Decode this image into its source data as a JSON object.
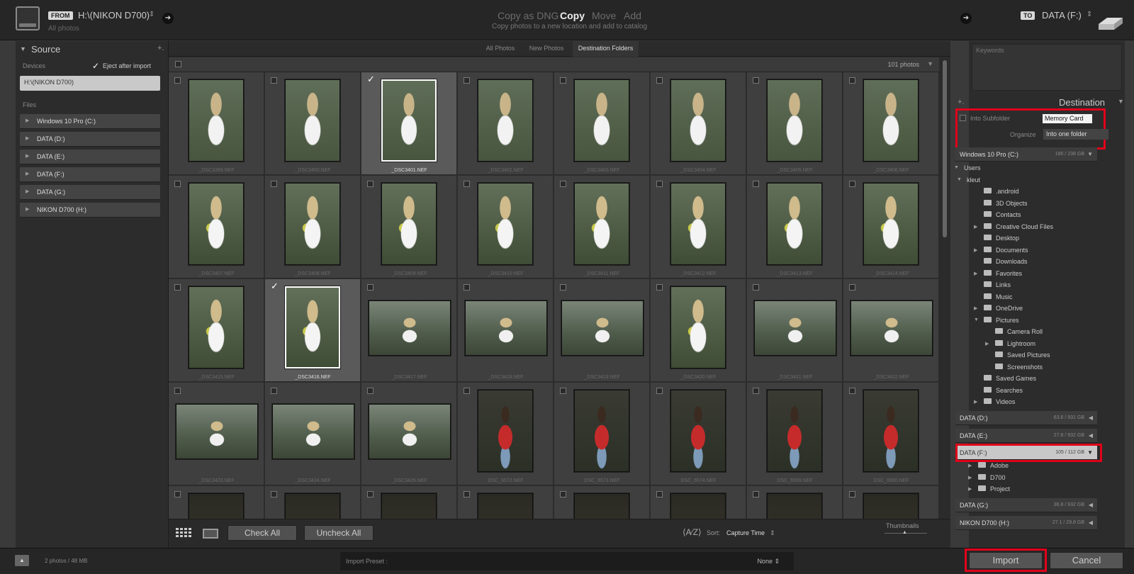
{
  "topbar": {
    "from_tag": "FROM",
    "source_name": "H:\\(NIKON D700)",
    "source_arrow": "⇕",
    "source_sub": "All photos",
    "modes": [
      "Copy as DNG",
      "Copy",
      "Move",
      "Add"
    ],
    "active_mode": "Copy",
    "mode_desc": "Copy photos to a new location and add to catalog",
    "to_tag": "TO",
    "dest_name": "DATA (F:)",
    "dest_arrow": "⇕"
  },
  "left": {
    "title": "Source",
    "plus": "+.",
    "devices_label": "Devices",
    "eject_label": "Eject after import",
    "device_selected": "H:\\(NIKON D700)",
    "files_label": "Files",
    "drives": [
      "Windows 10 Pro (C:)",
      "DATA (D:)",
      "DATA (E:)",
      "DATA (F:)",
      "DATA (G:)",
      "NIKON D700 (H:)"
    ]
  },
  "tabs": [
    "All Photos",
    "New Photos",
    "Destination Folders"
  ],
  "active_tab": "Destination Folders",
  "photo_count": "101 photos",
  "photos": [
    {
      "name": "_DSC3399.NEF",
      "checked": false,
      "orient": "p",
      "style": "ph-a"
    },
    {
      "name": "_DSC3400.NEF",
      "checked": false,
      "orient": "p",
      "style": "ph-a"
    },
    {
      "name": "_DSC3401.NEF",
      "checked": true,
      "orient": "p",
      "style": "ph-a"
    },
    {
      "name": "_DSC3402.NEF",
      "checked": false,
      "orient": "p",
      "style": "ph-a"
    },
    {
      "name": "_DSC3403.NEF",
      "checked": false,
      "orient": "p",
      "style": "ph-a"
    },
    {
      "name": "_DSC3404.NEF",
      "checked": false,
      "orient": "p",
      "style": "ph-a"
    },
    {
      "name": "_DSC3405.NEF",
      "checked": false,
      "orient": "p",
      "style": "ph-a"
    },
    {
      "name": "_DSC3406.NEF",
      "checked": false,
      "orient": "p",
      "style": "ph-a"
    },
    {
      "name": "_DSC3407.NEF",
      "checked": false,
      "orient": "p",
      "style": "ph-b"
    },
    {
      "name": "_DSC3408.NEF",
      "checked": false,
      "orient": "p",
      "style": "ph-b"
    },
    {
      "name": "_DSC3409.NEF",
      "checked": false,
      "orient": "p",
      "style": "ph-b"
    },
    {
      "name": "_DSC3410.NEF",
      "checked": false,
      "orient": "p",
      "style": "ph-b"
    },
    {
      "name": "_DSC3411.NEF",
      "checked": false,
      "orient": "p",
      "style": "ph-b"
    },
    {
      "name": "_DSC3412.NEF",
      "checked": false,
      "orient": "p",
      "style": "ph-b"
    },
    {
      "name": "_DSC3413.NEF",
      "checked": false,
      "orient": "p",
      "style": "ph-b"
    },
    {
      "name": "_DSC3414.NEF",
      "checked": false,
      "orient": "p",
      "style": "ph-b"
    },
    {
      "name": "_DSC3415.NEF",
      "checked": false,
      "orient": "p",
      "style": "ph-b"
    },
    {
      "name": "_DSC3416.NEF",
      "checked": true,
      "orient": "p",
      "style": "ph-b"
    },
    {
      "name": "_DSC3417.NEF",
      "checked": false,
      "orient": "l",
      "style": "ph-c"
    },
    {
      "name": "_DSC3418.NEF",
      "checked": false,
      "orient": "l",
      "style": "ph-c"
    },
    {
      "name": "_DSC3419.NEF",
      "checked": false,
      "orient": "l",
      "style": "ph-c"
    },
    {
      "name": "_DSC3420.NEF",
      "checked": false,
      "orient": "p",
      "style": "ph-b"
    },
    {
      "name": "_DSC3421.NEF",
      "checked": false,
      "orient": "l",
      "style": "ph-c"
    },
    {
      "name": "_DSC3422.NEF",
      "checked": false,
      "orient": "l",
      "style": "ph-c"
    },
    {
      "name": "_DSC3423.NEF",
      "checked": false,
      "orient": "l",
      "style": "ph-c"
    },
    {
      "name": "_DSC3424.NEF",
      "checked": false,
      "orient": "l",
      "style": "ph-c"
    },
    {
      "name": "_DSC3426.NEF",
      "checked": false,
      "orient": "l",
      "style": "ph-c"
    },
    {
      "name": "DSC_6572.NEF",
      "checked": false,
      "orient": "p",
      "style": "ph-d"
    },
    {
      "name": "DSC_6573.NEF",
      "checked": false,
      "orient": "p",
      "style": "ph-d"
    },
    {
      "name": "DSC_6574.NEF",
      "checked": false,
      "orient": "p",
      "style": "ph-d"
    },
    {
      "name": "DSC_6599.NEF",
      "checked": false,
      "orient": "p",
      "style": "ph-d"
    },
    {
      "name": "DSC_6600.NEF",
      "checked": false,
      "orient": "p",
      "style": "ph-d"
    },
    {
      "name": "",
      "checked": false,
      "orient": "p",
      "style": "ph-e"
    },
    {
      "name": "",
      "checked": false,
      "orient": "p",
      "style": "ph-e"
    },
    {
      "name": "",
      "checked": false,
      "orient": "p",
      "style": "ph-e"
    },
    {
      "name": "",
      "checked": false,
      "orient": "p",
      "style": "ph-e"
    },
    {
      "name": "",
      "checked": false,
      "orient": "p",
      "style": "ph-e"
    },
    {
      "name": "",
      "checked": false,
      "orient": "p",
      "style": "ph-e"
    },
    {
      "name": "",
      "checked": false,
      "orient": "p",
      "style": "ph-e"
    },
    {
      "name": "",
      "checked": false,
      "orient": "p",
      "style": "ph-e"
    }
  ],
  "gridbar": {
    "check_all": "Check All",
    "uncheck_all": "Uncheck All",
    "sort_label": "Sort:",
    "sort_value": "Capture Time",
    "sort_arrow": "⇕",
    "thumbnails_label": "Thumbnails"
  },
  "right": {
    "keywords_label": "Keywords",
    "plus": "+.",
    "destination_title": "Destination",
    "into_subfolder_label": "Into Subfolder",
    "subfolder_value": "Memory Card",
    "organize_label": "Organize",
    "organize_value": "Into one folder",
    "volumes": [
      {
        "name": "Windows 10 Pro (C:)",
        "cap": "185 / 238 GB"
      },
      {
        "name": "DATA (D:)",
        "cap": "63.6 / 931 GB"
      },
      {
        "name": "DATA (E:)",
        "cap": "27.8 / 932 GB"
      },
      {
        "name": "DATA (F:)",
        "cap": "105 / 112 GB"
      },
      {
        "name": "DATA (G:)",
        "cap": "36.8 / 932 GB"
      },
      {
        "name": "NIKON D700 (H:)",
        "cap": "27.1 / 29.8 GB"
      }
    ],
    "c_tree": [
      {
        "label": "Users",
        "lvl": 0,
        "tri": "▼"
      },
      {
        "label": "kleut",
        "lvl": 1,
        "tri": "▼"
      },
      {
        "label": ".android",
        "lvl": 2,
        "tri": ""
      },
      {
        "label": "3D Objects",
        "lvl": 2,
        "tri": ""
      },
      {
        "label": "Contacts",
        "lvl": 2,
        "tri": ""
      },
      {
        "label": "Creative Cloud Files",
        "lvl": 2,
        "tri": "▶"
      },
      {
        "label": "Desktop",
        "lvl": 2,
        "tri": ""
      },
      {
        "label": "Documents",
        "lvl": 2,
        "tri": "▶"
      },
      {
        "label": "Downloads",
        "lvl": 2,
        "tri": ""
      },
      {
        "label": "Favorites",
        "lvl": 2,
        "tri": "▶"
      },
      {
        "label": "Links",
        "lvl": 2,
        "tri": ""
      },
      {
        "label": "Music",
        "lvl": 2,
        "tri": ""
      },
      {
        "label": "OneDrive",
        "lvl": 2,
        "tri": "▶"
      },
      {
        "label": "Pictures",
        "lvl": 2,
        "tri": "▼"
      },
      {
        "label": "Camera Roll",
        "lvl": 3,
        "tri": ""
      },
      {
        "label": "Lightroom",
        "lvl": 3,
        "tri": "▶"
      },
      {
        "label": "Saved Pictures",
        "lvl": 3,
        "tri": ""
      },
      {
        "label": "Screenshots",
        "lvl": 3,
        "tri": ""
      },
      {
        "label": "Saved Games",
        "lvl": 2,
        "tri": ""
      },
      {
        "label": "Searches",
        "lvl": 2,
        "tri": ""
      },
      {
        "label": "Videos",
        "lvl": 2,
        "tri": "▶"
      }
    ],
    "f_tree": [
      {
        "label": "Adobe",
        "tri": "▶"
      },
      {
        "label": "D700",
        "tri": "▶"
      },
      {
        "label": "Project",
        "tri": "▶"
      }
    ]
  },
  "bottom": {
    "status": "2 photos / 48 MB",
    "preset_label": "Import Preset :",
    "preset_value": "None ⇕",
    "import_label": "Import",
    "cancel_label": "Cancel"
  },
  "highlight_color": "#e0001a"
}
